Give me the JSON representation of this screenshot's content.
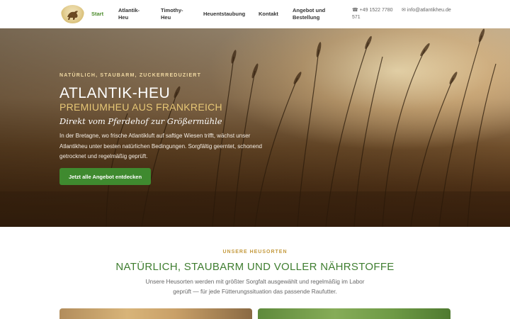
{
  "header": {
    "logo_text": "Pferdehof zur Größermühle",
    "nav": [
      {
        "label": "Start",
        "active": true
      },
      {
        "label": "Atlantik-Heu",
        "active": false
      },
      {
        "label": "Timothy-Heu",
        "active": false
      },
      {
        "label": "Heuentstaubung",
        "active": false
      },
      {
        "label": "Kontakt",
        "active": false
      },
      {
        "label": "Angebot und Bestellung",
        "active": false
      }
    ],
    "phone": "☎ +49 1522 7780 571",
    "email": "✉ info@atlantikheu.de"
  },
  "hero": {
    "eyebrow": "NATÜRLICH, STAUBARM, ZUCKERREDUZIERT",
    "title": "ATLANTIK-HEU",
    "subtitle": "PREMIUMHEU AUS FRANKREICH",
    "script": "Direkt vom Pferdehof zur Größermühle",
    "text": "In der Bretagne, wo frische Atlantikluft auf saftige Wiesen trifft, wächst unser Atlantikheu unter besten natürlichen Bedingungen. Sorgfältig geerntet, schonend getrocknet und regelmäßig geprüft.",
    "cta": "Jetzt alle Angebot entdecken"
  },
  "section": {
    "eyebrow": "UNSERE HEUSORTEN",
    "title": "NATÜRLICH, STAUBARM UND VOLLER NÄHRSTOFFE",
    "text": "Unsere Heusorten werden mit größter Sorgfalt ausgewählt und regelmäßig im Labor geprüft — für jede Fütterungssituation das passende Raufutter."
  },
  "colors": {
    "accent_green": "#3f8a2f",
    "nav_active": "#4b8b2b",
    "gold": "#c49a3e"
  }
}
